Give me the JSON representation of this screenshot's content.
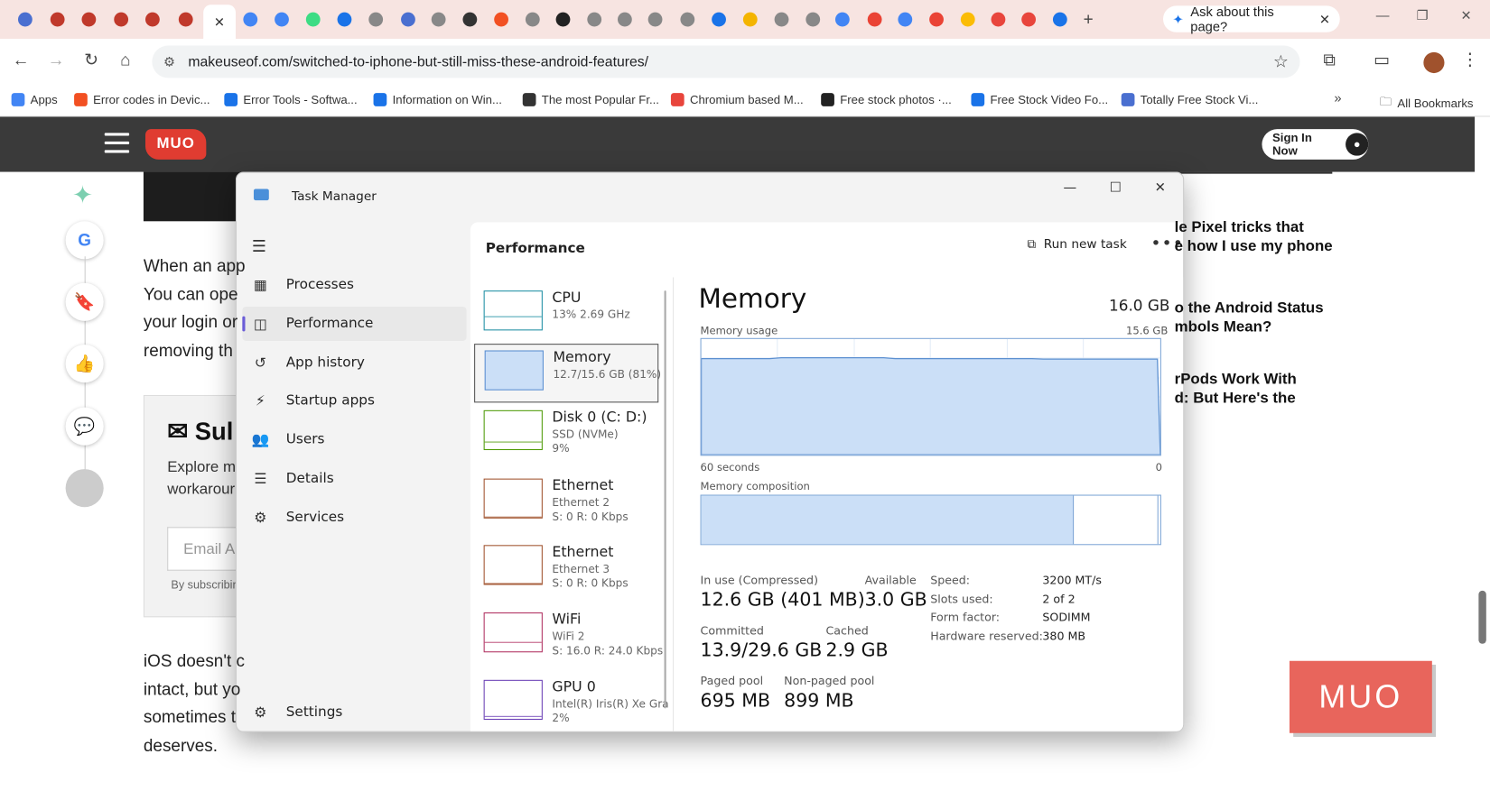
{
  "browser": {
    "tab_ask_label": "Ask about this page?",
    "address": "makeuseof.com/switched-to-iphone-but-still-miss-these-android-features/",
    "tabs_favicon_colors": [
      "#4a6fd0",
      "#c0392b",
      "#c0392b",
      "#c0392b",
      "#c0392b",
      "#c0392b",
      "#c0392b",
      "#4285f4",
      "#4285f4",
      "#3ddc84",
      "#1a73e8",
      "#888",
      "#4a6fd0",
      "#888",
      "#333",
      "#f25022",
      "#888",
      "#222",
      "#888",
      "#888",
      "#888",
      "#888",
      "#1a73e8",
      "#f4b400",
      "#888",
      "#888",
      "#4285f4",
      "#ea4335",
      "#4285f4",
      "#ea4335",
      "#fbbc05",
      "#e8453c",
      "#e8453c",
      "#1a73e8"
    ],
    "bookmarks": [
      {
        "label": "Apps",
        "color": "#4285f4"
      },
      {
        "label": "Error codes in Devic...",
        "color": "#f25022"
      },
      {
        "label": "Error Tools - Softwa...",
        "color": "#1a73e8"
      },
      {
        "label": "Information on Win...",
        "color": "#1a73e8"
      },
      {
        "label": "The most Popular Fr...",
        "color": "#333"
      },
      {
        "label": "Chromium based M...",
        "color": "#e8453c"
      },
      {
        "label": "Free stock photos ·...",
        "color": "#222"
      },
      {
        "label": "Free Stock Video Fo...",
        "color": "#1a73e8"
      },
      {
        "label": "Totally Free Stock Vi...",
        "color": "#4a6fd0"
      }
    ],
    "all_bookmarks": "All Bookmarks"
  },
  "site": {
    "logo": "MUO",
    "sign_in": "Sign In Now",
    "article_lines_1": [
      "When an app",
      "You can ope",
      "your login or",
      "removing th"
    ],
    "subscribe_title": "Sul",
    "subscribe_text": [
      "Explore m",
      "workarour"
    ],
    "email_placeholder": "Email A",
    "by_subscribing": "By subscribin",
    "article_lines_2": [
      "iOS doesn't c",
      "intact, but yo",
      "sometimes t",
      "deserves."
    ],
    "sidebar_titles": [
      [
        "le Pixel tricks that",
        "e how I use my phone"
      ],
      [
        "o the Android Status",
        "mbols Mean?"
      ],
      [
        "rPods Work With",
        "d: But Here's the"
      ]
    ],
    "watermark": "MUO"
  },
  "task_manager": {
    "title": "Task Manager",
    "nav": [
      {
        "label": "Processes",
        "icon": "processes-icon",
        "glyph": "▦"
      },
      {
        "label": "Performance",
        "icon": "performance-icon",
        "glyph": "◫"
      },
      {
        "label": "App history",
        "icon": "history-icon",
        "glyph": "↺"
      },
      {
        "label": "Startup apps",
        "icon": "startup-icon",
        "glyph": "⚡"
      },
      {
        "label": "Users",
        "icon": "users-icon",
        "glyph": "👥"
      },
      {
        "label": "Details",
        "icon": "details-icon",
        "glyph": "☰"
      },
      {
        "label": "Services",
        "icon": "services-icon",
        "glyph": "⚙"
      }
    ],
    "settings": "Settings",
    "header": "Performance",
    "run_new_task": "Run new task",
    "resources": [
      {
        "name": "CPU",
        "sub": [
          "13%  2.69 GHz"
        ],
        "color": "#1e8ea3"
      },
      {
        "name": "Memory",
        "sub": [
          "12.7/15.6 GB (81%)"
        ],
        "color": "#5b8fd0"
      },
      {
        "name": "Disk 0 (C: D:)",
        "sub": [
          "SSD (NVMe)",
          "9%"
        ],
        "color": "#4e9a06"
      },
      {
        "name": "Ethernet",
        "sub": [
          "Ethernet 2",
          "S: 0  R: 0 Kbps"
        ],
        "color": "#a0522d"
      },
      {
        "name": "Ethernet",
        "sub": [
          "Ethernet 3",
          "S: 0  R: 0 Kbps"
        ],
        "color": "#a0522d"
      },
      {
        "name": "WiFi",
        "sub": [
          "WiFi 2",
          "S: 16.0  R: 24.0 Kbps"
        ],
        "color": "#b03060"
      },
      {
        "name": "GPU 0",
        "sub": [
          "Intel(R) Iris(R) Xe Gra",
          "2%"
        ],
        "color": "#6a3fb5"
      }
    ],
    "memory": {
      "title": "Memory",
      "total": "16.0 GB",
      "usage_label": "Memory usage",
      "usage_max": "15.6 GB",
      "axis_left": "60 seconds",
      "axis_right": "0",
      "composition_label": "Memory composition",
      "in_use_label": "In use (Compressed)",
      "in_use_value": "12.6 GB (401 MB)",
      "available_label": "Available",
      "available_value": "3.0 GB",
      "committed_label": "Committed",
      "committed_value": "13.9/29.6 GB",
      "cached_label": "Cached",
      "cached_value": "2.9 GB",
      "paged_label": "Paged pool",
      "paged_value": "695 MB",
      "nonpaged_label": "Non-paged pool",
      "nonpaged_value": "899 MB",
      "specs": [
        {
          "k": "Speed:",
          "v": "3200 MT/s"
        },
        {
          "k": "Slots used:",
          "v": "2 of 2"
        },
        {
          "k": "Form factor:",
          "v": "SODIMM"
        },
        {
          "k": "Hardware reserved:",
          "v": "380 MB"
        }
      ],
      "usage_fraction": 0.81
    }
  }
}
